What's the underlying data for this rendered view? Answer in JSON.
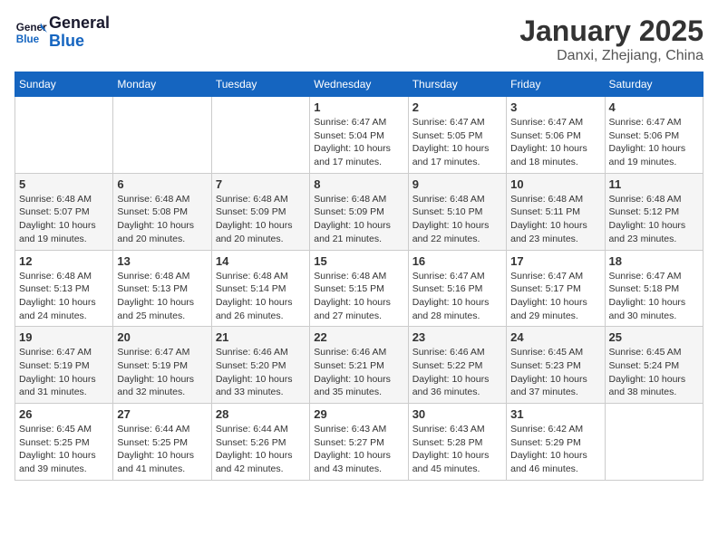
{
  "header": {
    "logo_line1": "General",
    "logo_line2": "Blue",
    "month_title": "January 2025",
    "location": "Danxi, Zhejiang, China"
  },
  "days_of_week": [
    "Sunday",
    "Monday",
    "Tuesday",
    "Wednesday",
    "Thursday",
    "Friday",
    "Saturday"
  ],
  "weeks": [
    [
      {
        "day": "",
        "info": ""
      },
      {
        "day": "",
        "info": ""
      },
      {
        "day": "",
        "info": ""
      },
      {
        "day": "1",
        "info": "Sunrise: 6:47 AM\nSunset: 5:04 PM\nDaylight: 10 hours and 17 minutes."
      },
      {
        "day": "2",
        "info": "Sunrise: 6:47 AM\nSunset: 5:05 PM\nDaylight: 10 hours and 17 minutes."
      },
      {
        "day": "3",
        "info": "Sunrise: 6:47 AM\nSunset: 5:06 PM\nDaylight: 10 hours and 18 minutes."
      },
      {
        "day": "4",
        "info": "Sunrise: 6:47 AM\nSunset: 5:06 PM\nDaylight: 10 hours and 19 minutes."
      }
    ],
    [
      {
        "day": "5",
        "info": "Sunrise: 6:48 AM\nSunset: 5:07 PM\nDaylight: 10 hours and 19 minutes."
      },
      {
        "day": "6",
        "info": "Sunrise: 6:48 AM\nSunset: 5:08 PM\nDaylight: 10 hours and 20 minutes."
      },
      {
        "day": "7",
        "info": "Sunrise: 6:48 AM\nSunset: 5:09 PM\nDaylight: 10 hours and 20 minutes."
      },
      {
        "day": "8",
        "info": "Sunrise: 6:48 AM\nSunset: 5:09 PM\nDaylight: 10 hours and 21 minutes."
      },
      {
        "day": "9",
        "info": "Sunrise: 6:48 AM\nSunset: 5:10 PM\nDaylight: 10 hours and 22 minutes."
      },
      {
        "day": "10",
        "info": "Sunrise: 6:48 AM\nSunset: 5:11 PM\nDaylight: 10 hours and 23 minutes."
      },
      {
        "day": "11",
        "info": "Sunrise: 6:48 AM\nSunset: 5:12 PM\nDaylight: 10 hours and 23 minutes."
      }
    ],
    [
      {
        "day": "12",
        "info": "Sunrise: 6:48 AM\nSunset: 5:13 PM\nDaylight: 10 hours and 24 minutes."
      },
      {
        "day": "13",
        "info": "Sunrise: 6:48 AM\nSunset: 5:13 PM\nDaylight: 10 hours and 25 minutes."
      },
      {
        "day": "14",
        "info": "Sunrise: 6:48 AM\nSunset: 5:14 PM\nDaylight: 10 hours and 26 minutes."
      },
      {
        "day": "15",
        "info": "Sunrise: 6:48 AM\nSunset: 5:15 PM\nDaylight: 10 hours and 27 minutes."
      },
      {
        "day": "16",
        "info": "Sunrise: 6:47 AM\nSunset: 5:16 PM\nDaylight: 10 hours and 28 minutes."
      },
      {
        "day": "17",
        "info": "Sunrise: 6:47 AM\nSunset: 5:17 PM\nDaylight: 10 hours and 29 minutes."
      },
      {
        "day": "18",
        "info": "Sunrise: 6:47 AM\nSunset: 5:18 PM\nDaylight: 10 hours and 30 minutes."
      }
    ],
    [
      {
        "day": "19",
        "info": "Sunrise: 6:47 AM\nSunset: 5:19 PM\nDaylight: 10 hours and 31 minutes."
      },
      {
        "day": "20",
        "info": "Sunrise: 6:47 AM\nSunset: 5:19 PM\nDaylight: 10 hours and 32 minutes."
      },
      {
        "day": "21",
        "info": "Sunrise: 6:46 AM\nSunset: 5:20 PM\nDaylight: 10 hours and 33 minutes."
      },
      {
        "day": "22",
        "info": "Sunrise: 6:46 AM\nSunset: 5:21 PM\nDaylight: 10 hours and 35 minutes."
      },
      {
        "day": "23",
        "info": "Sunrise: 6:46 AM\nSunset: 5:22 PM\nDaylight: 10 hours and 36 minutes."
      },
      {
        "day": "24",
        "info": "Sunrise: 6:45 AM\nSunset: 5:23 PM\nDaylight: 10 hours and 37 minutes."
      },
      {
        "day": "25",
        "info": "Sunrise: 6:45 AM\nSunset: 5:24 PM\nDaylight: 10 hours and 38 minutes."
      }
    ],
    [
      {
        "day": "26",
        "info": "Sunrise: 6:45 AM\nSunset: 5:25 PM\nDaylight: 10 hours and 39 minutes."
      },
      {
        "day": "27",
        "info": "Sunrise: 6:44 AM\nSunset: 5:25 PM\nDaylight: 10 hours and 41 minutes."
      },
      {
        "day": "28",
        "info": "Sunrise: 6:44 AM\nSunset: 5:26 PM\nDaylight: 10 hours and 42 minutes."
      },
      {
        "day": "29",
        "info": "Sunrise: 6:43 AM\nSunset: 5:27 PM\nDaylight: 10 hours and 43 minutes."
      },
      {
        "day": "30",
        "info": "Sunrise: 6:43 AM\nSunset: 5:28 PM\nDaylight: 10 hours and 45 minutes."
      },
      {
        "day": "31",
        "info": "Sunrise: 6:42 AM\nSunset: 5:29 PM\nDaylight: 10 hours and 46 minutes."
      },
      {
        "day": "",
        "info": ""
      }
    ]
  ]
}
